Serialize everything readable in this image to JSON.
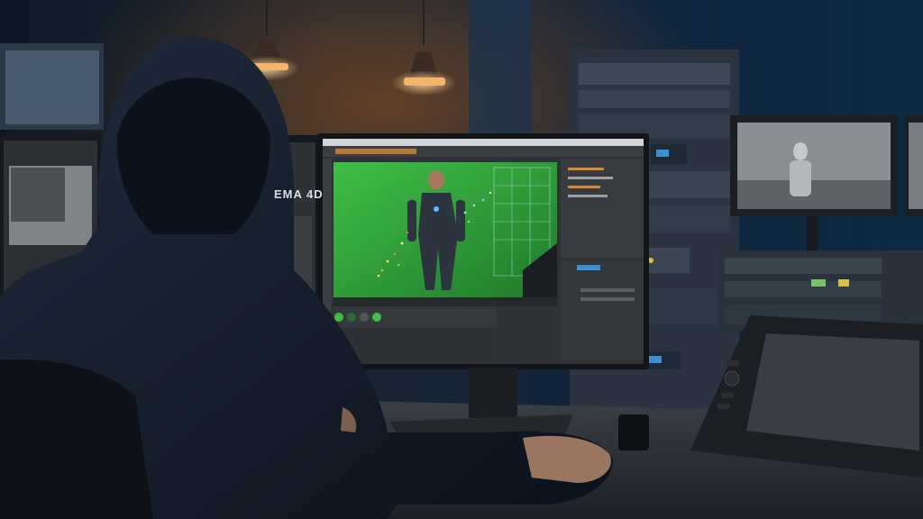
{
  "scene": {
    "left_monitor": {
      "brand_text": "EMA 4D"
    },
    "colors": {
      "room_bg": "#0b1826",
      "green_screen": "#2fa43a",
      "ui_dark": "#2e3236",
      "ui_panel": "#3a3e42",
      "accent_orange": "#d8892e",
      "accent_blue": "#3e8fd0",
      "lamp": "#f2b56a",
      "hoodie": "#141c2a",
      "desk": "#2b2f35"
    },
    "icons": [
      "lamp-icon",
      "server-rack",
      "graphics-tablet",
      "keyboard",
      "mug"
    ]
  }
}
